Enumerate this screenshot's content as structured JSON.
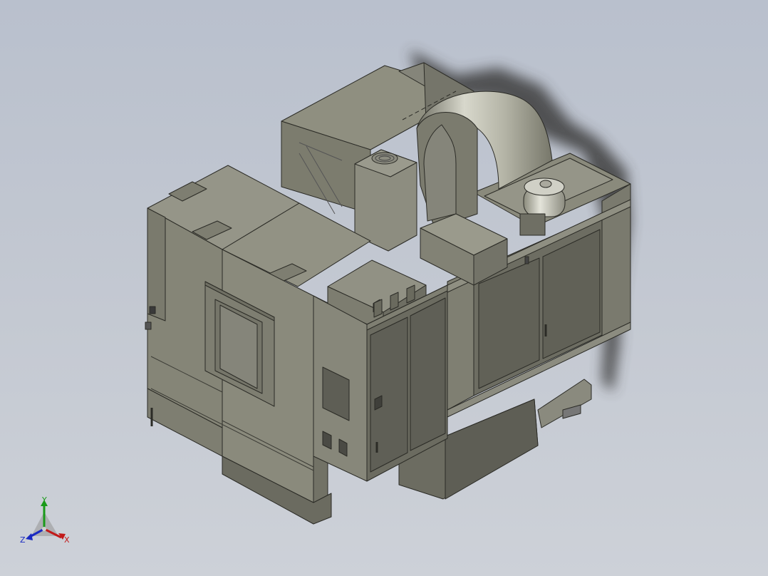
{
  "viewport": {
    "background_top": "#b9c0cd",
    "background_bottom": "#cdd1d8"
  },
  "model": {
    "description_icon": "cnc-machining-center-model",
    "body_color": "#8e8e7f",
    "edge_color": "#2b2b26"
  },
  "triad": {
    "x_label": "X",
    "y_label": "Y",
    "z_label": "Z",
    "x_color": "#c21a1a",
    "y_color": "#1a9a1a",
    "z_color": "#1a2ac2"
  }
}
